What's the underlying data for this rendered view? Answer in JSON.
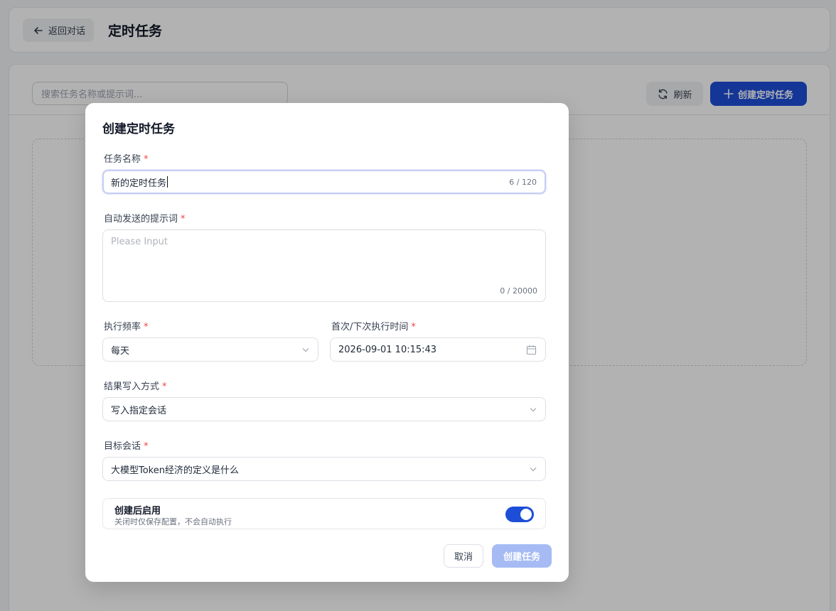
{
  "header": {
    "back_label": "返回对话",
    "title": "定时任务"
  },
  "toolbar": {
    "search_placeholder": "搜索任务名称或提示词...",
    "refresh_label": "刷新",
    "create_label": "创建定时任务"
  },
  "dialog": {
    "title": "创建定时任务",
    "name": {
      "label": "任务名称",
      "value": "新的定时任务",
      "counter": "6 / 120"
    },
    "prompt": {
      "label": "自动发送的提示词",
      "placeholder": "Please Input",
      "counter": "0 / 20000"
    },
    "frequency": {
      "label": "执行频率",
      "value": "每天"
    },
    "run_time": {
      "label": "首次/下次执行时间",
      "value": "2026-09-01 10:15:43"
    },
    "write_mode": {
      "label": "结果写入方式",
      "value": "写入指定会话"
    },
    "target": {
      "label": "目标会话",
      "value": "大模型Token经济的定义是什么"
    },
    "enable": {
      "title": "创建后启用",
      "desc": "关闭时仅保存配置，不会自动执行",
      "on": true
    },
    "cancel_label": "取消",
    "submit_label": "创建任务",
    "required_mark": "*"
  },
  "colors": {
    "primary": "#1d4ed8",
    "required": "#ef4444",
    "submit_disabled": "#a6bbf3"
  }
}
